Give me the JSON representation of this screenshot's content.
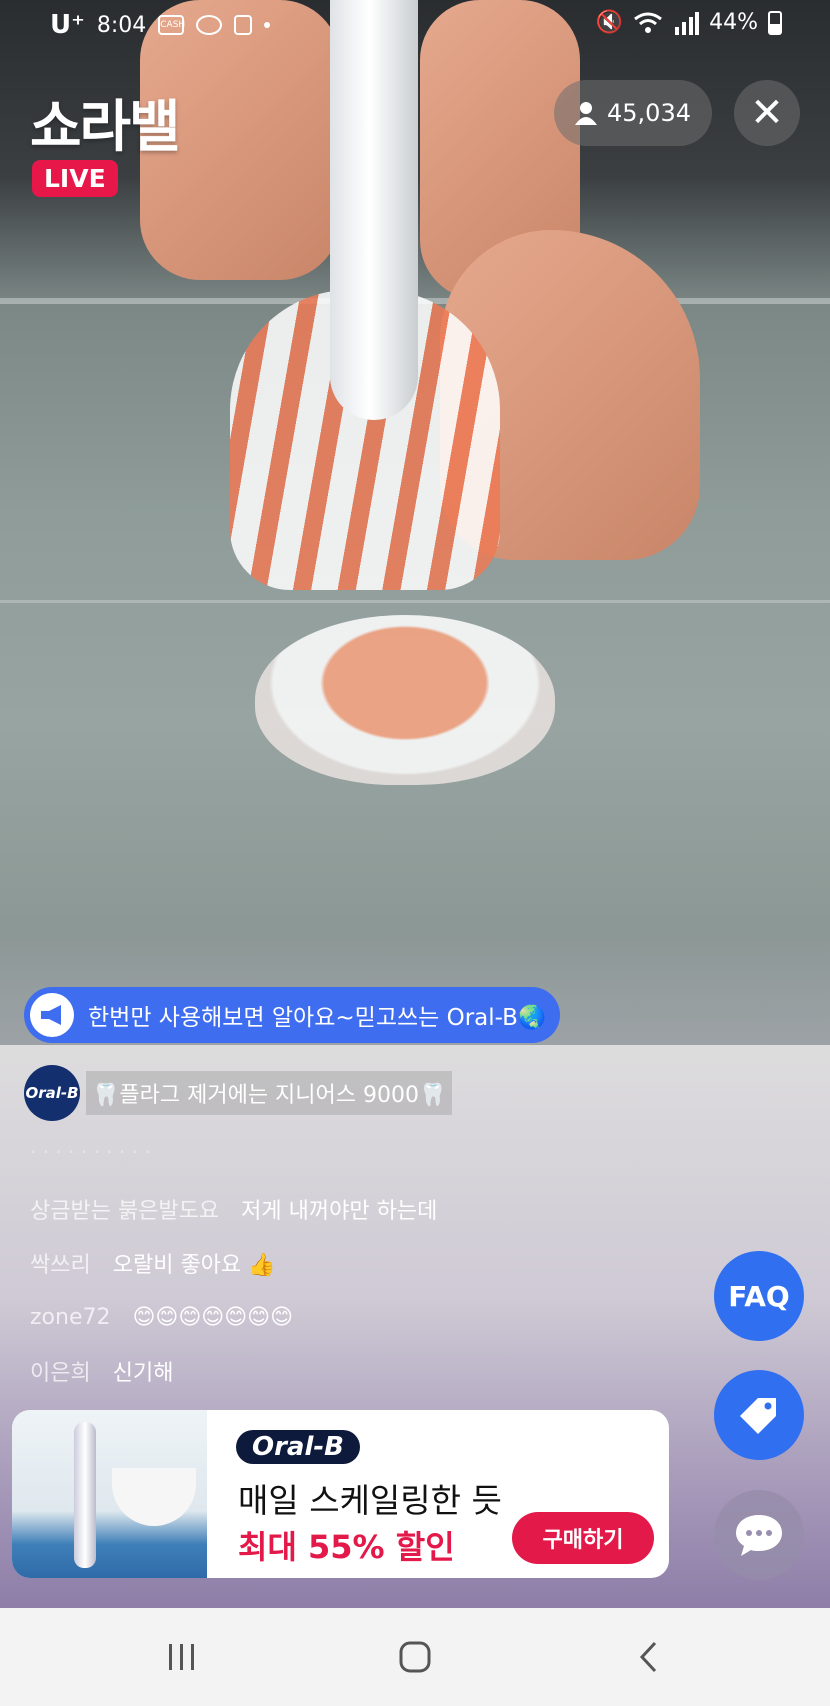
{
  "status_bar": {
    "carrier": "U⁺",
    "time": "8:04",
    "battery": "44%"
  },
  "header": {
    "logo": "쇼라밸",
    "live_badge": "LIVE",
    "viewer_count": "45,034"
  },
  "notice": {
    "text": "한번만 사용해보면 알아요~믿고쓰는 Oral-B🌏"
  },
  "host_message": {
    "avatar_label": "Oral-B",
    "text": "🦷플라그 제거에는 지니어스 9000🦷"
  },
  "chat": {
    "faded": "· · · · · · · · · ·",
    "messages": [
      {
        "user": "상금받는 붉은발도요",
        "text": "저게 내꺼야만 하는데"
      },
      {
        "user": "싹쓰리",
        "text": "오랄비 좋아요 👍"
      },
      {
        "user": "zone72",
        "text": "😊😊😊😊😊😊😊"
      },
      {
        "user": "이은희",
        "text": "신기해"
      }
    ]
  },
  "side_buttons": {
    "faq": "FAQ"
  },
  "banner": {
    "brand": "Oral-B",
    "title": "매일 스케일링한 듯",
    "sale": "최대 55% 할인",
    "buy_label": "구매하기"
  },
  "colors": {
    "accent_blue": "#2f6ff0",
    "live_red": "#e8174a",
    "sale_red": "#e3194a",
    "brand_navy": "#0d1a3c"
  }
}
